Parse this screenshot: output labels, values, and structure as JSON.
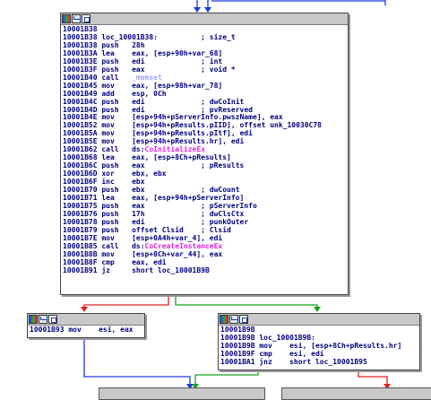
{
  "colors": {
    "edge_blue": "#1a3ae0",
    "edge_green": "#1aa01a",
    "edge_red": "#e02020",
    "highlight": "#8080ff",
    "api": "#e020e0"
  },
  "toolbar_icons": [
    "color-icon",
    "graph-icon",
    "group-icon"
  ],
  "main_block": [
    {
      "addr": "10001B38",
      "mn": "",
      "op": "",
      "cm": ""
    },
    {
      "addr": "10001B38",
      "mn": "loc_10001B38:",
      "op": "",
      "cm": "; size_t"
    },
    {
      "addr": "10001B38",
      "mn": "push",
      "op": "28h",
      "cm": ""
    },
    {
      "addr": "10001B3A",
      "mn": "lea",
      "op": "eax, [esp+90h+var_68]",
      "cm": ""
    },
    {
      "addr": "10001B3E",
      "mn": "push",
      "op": "edi",
      "cm": "; int"
    },
    {
      "addr": "10001B3F",
      "mn": "push",
      "op": "eax",
      "cm": "; void *"
    },
    {
      "addr": "10001B40",
      "mn": "call",
      "op": "_memset",
      "cm": "",
      "op_class": "hl"
    },
    {
      "addr": "10001B45",
      "mn": "mov",
      "op": "eax, [esp+98h+var_78]",
      "cm": ""
    },
    {
      "addr": "10001B49",
      "mn": "add",
      "op": "esp, 0Ch",
      "cm": ""
    },
    {
      "addr": "10001B4C",
      "mn": "push",
      "op": "edi",
      "cm": "; dwCoInit"
    },
    {
      "addr": "10001B4D",
      "mn": "push",
      "op": "edi",
      "cm": "; pvReserved"
    },
    {
      "addr": "10001B4E",
      "mn": "mov",
      "op": "[esp+94h+pServerInfo.pwszName], eax",
      "cm": ""
    },
    {
      "addr": "10001B52",
      "mn": "mov",
      "op": "[esp+94h+pResults.pIID], offset unk_10030C78",
      "cm": ""
    },
    {
      "addr": "10001B5A",
      "mn": "mov",
      "op": "[esp+94h+pResults.pItf], edi",
      "cm": ""
    },
    {
      "addr": "10001B5E",
      "mn": "mov",
      "op": "[esp+94h+pResults.hr], edi",
      "cm": ""
    },
    {
      "addr": "10001B62",
      "mn": "call",
      "op_pre": "ds:",
      "op": "CoInitializeEx",
      "cm": "",
      "op_class": "fn"
    },
    {
      "addr": "10001B68",
      "mn": "lea",
      "op": "eax, [esp+8Ch+pResults]",
      "cm": ""
    },
    {
      "addr": "10001B6C",
      "mn": "push",
      "op": "eax",
      "cm": "; pResults"
    },
    {
      "addr": "10001B6D",
      "mn": "xor",
      "op": "ebx, ebx",
      "cm": ""
    },
    {
      "addr": "10001B6F",
      "mn": "inc",
      "op": "ebx",
      "cm": ""
    },
    {
      "addr": "10001B70",
      "mn": "push",
      "op": "ebx",
      "cm": "; dwCount"
    },
    {
      "addr": "10001B71",
      "mn": "lea",
      "op": "eax, [esp+94h+pServerInfo]",
      "cm": ""
    },
    {
      "addr": "10001B75",
      "mn": "push",
      "op": "eax",
      "cm": "; pServerInfo"
    },
    {
      "addr": "10001B76",
      "mn": "push",
      "op": "17h",
      "cm": "; dwClsCtx"
    },
    {
      "addr": "10001B78",
      "mn": "push",
      "op": "edi",
      "cm": "; punkOuter"
    },
    {
      "addr": "10001B79",
      "mn": "push",
      "op": "offset Clsid",
      "cm": "; Clsid"
    },
    {
      "addr": "10001B7E",
      "mn": "mov",
      "op": "[esp+0A4h+var_4], edi",
      "cm": ""
    },
    {
      "addr": "10001B85",
      "mn": "call",
      "op_pre": "ds:",
      "op": "CoCreateInstanceEx",
      "cm": "",
      "op_class": "fn"
    },
    {
      "addr": "10001B8B",
      "mn": "mov",
      "op": "[esp+8Ch+var_44], eax",
      "cm": ""
    },
    {
      "addr": "10001B8F",
      "mn": "cmp",
      "op": "eax, edi",
      "cm": ""
    },
    {
      "addr": "10001B91",
      "mn": "jz",
      "op": "short loc_10001B9B",
      "cm": ""
    }
  ],
  "left_block": [
    {
      "addr": "10001B93",
      "mn": "mov",
      "op": "esi, eax",
      "cm": ""
    }
  ],
  "right_block": [
    {
      "addr": "10001B9B",
      "mn": "",
      "op": "",
      "cm": ""
    },
    {
      "addr": "10001B9B",
      "mn": "loc_10001B9B:",
      "op": "",
      "cm": ""
    },
    {
      "addr": "10001B9B",
      "mn": "mov",
      "op": "esi, [esp+8Ch+pResults.hr]",
      "cm": ""
    },
    {
      "addr": "10001B9F",
      "mn": "cmp",
      "op": "esi, edi",
      "cm": ""
    },
    {
      "addr": "10001BA1",
      "mn": "jnz",
      "op": "short loc_10001B95",
      "cm": ""
    }
  ]
}
